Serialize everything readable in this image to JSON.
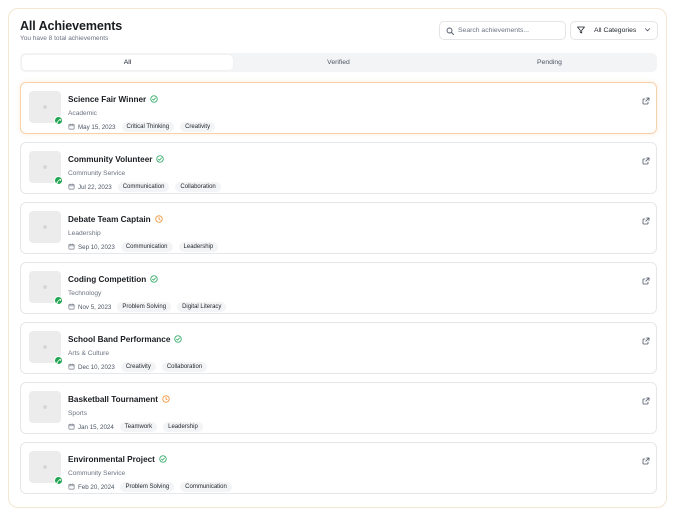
{
  "header": {
    "title": "All Achievements",
    "subtitle": "You have 8 total achievements"
  },
  "search": {
    "placeholder": "Search achievements..."
  },
  "category_filter": {
    "selected": "All Categories"
  },
  "tabs": [
    {
      "label": "All",
      "active": true
    },
    {
      "label": "Verified",
      "active": false
    },
    {
      "label": "Pending",
      "active": false
    }
  ],
  "colors": {
    "verified": "#22a55a",
    "pending": "#f08c2e",
    "badge": "#1ea44f"
  },
  "achievements": [
    {
      "name": "Science Fair Winner",
      "category": "Academic",
      "date": "May 15, 2023",
      "status": "verified",
      "badge": true,
      "tags": [
        "Critical Thinking",
        "Creativity"
      ]
    },
    {
      "name": "Community Volunteer",
      "category": "Community Service",
      "date": "Jul 22, 2023",
      "status": "verified",
      "badge": true,
      "tags": [
        "Communication",
        "Collaboration"
      ]
    },
    {
      "name": "Debate Team Captain",
      "category": "Leadership",
      "date": "Sep 10, 2023",
      "status": "pending",
      "badge": false,
      "tags": [
        "Communication",
        "Leadership"
      ]
    },
    {
      "name": "Coding Competition",
      "category": "Technology",
      "date": "Nov 5, 2023",
      "status": "verified",
      "badge": true,
      "tags": [
        "Problem Solving",
        "Digital Literacy"
      ]
    },
    {
      "name": "School Band Performance",
      "category": "Arts & Culture",
      "date": "Dec 10, 2023",
      "status": "verified",
      "badge": true,
      "tags": [
        "Creativity",
        "Collaboration"
      ]
    },
    {
      "name": "Basketball Tournament",
      "category": "Sports",
      "date": "Jan 15, 2024",
      "status": "pending",
      "badge": false,
      "tags": [
        "Teamwork",
        "Leadership"
      ]
    },
    {
      "name": "Environmental Project",
      "category": "Community Service",
      "date": "Feb 20, 2024",
      "status": "verified",
      "badge": true,
      "tags": [
        "Problem Solving",
        "Communication"
      ]
    }
  ]
}
